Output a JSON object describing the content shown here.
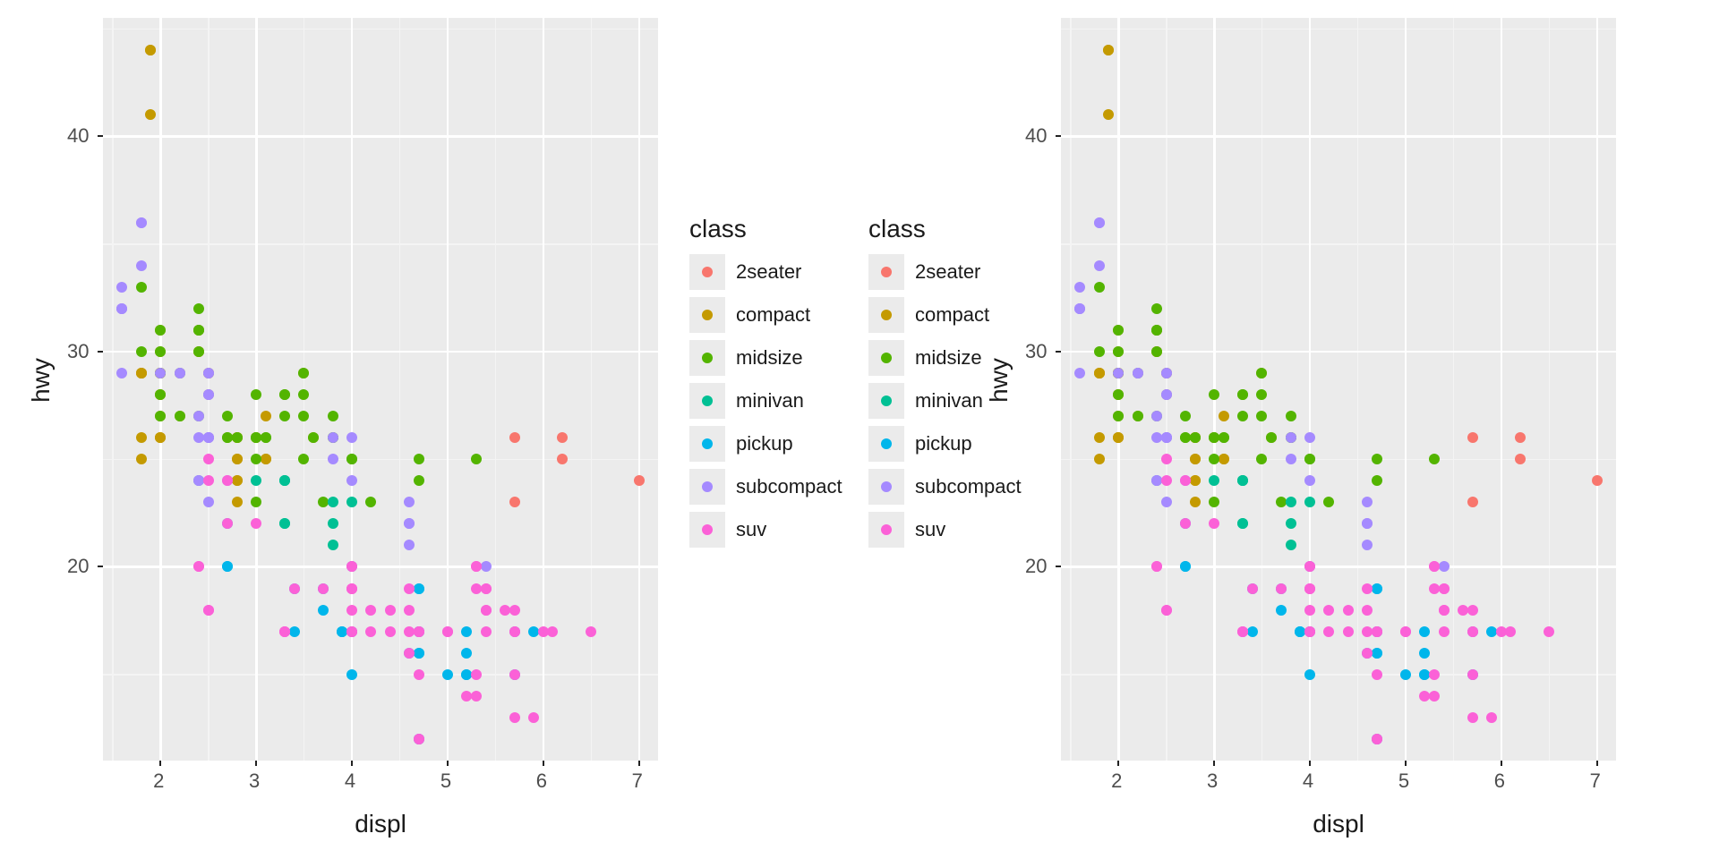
{
  "chart_data": [
    {
      "type": "scatter",
      "title": "",
      "xlabel": "displ",
      "ylabel": "hwy",
      "xlim": [
        1.4,
        7.2
      ],
      "ylim": [
        11,
        45.5
      ],
      "x_ticks": [
        2,
        3,
        4,
        5,
        6,
        7
      ],
      "y_ticks": [
        20,
        30,
        40
      ],
      "x_minor": [
        1.5,
        2.5,
        3.5,
        4.5,
        5.5,
        6.5
      ],
      "y_minor": [
        15,
        25,
        35,
        45
      ],
      "grid": true,
      "legend_title": "class",
      "legend_position": "right",
      "series": [
        {
          "name": "2seater",
          "color": "#F8766D",
          "x": [
            5.7,
            5.7,
            6.2,
            6.2,
            7.0
          ],
          "y": [
            26,
            23,
            26,
            25,
            24
          ]
        },
        {
          "name": "compact",
          "color": "#C49A00",
          "x": [
            1.8,
            1.8,
            2.0,
            2.0,
            2.8,
            2.8,
            3.1,
            1.8,
            1.8,
            2.0,
            2.0,
            2.8,
            2.8,
            3.1,
            3.1,
            2.4,
            2.4,
            2.0,
            2.0,
            2.0,
            2.0,
            2.8,
            1.9,
            2.0,
            2.0,
            2.0,
            2.0,
            2.5,
            2.5,
            2.8,
            2.8,
            1.9,
            1.9,
            2.0,
            2.0,
            2.5,
            2.5,
            1.8,
            1.8,
            2.0,
            2.0,
            2.8,
            2.8,
            3.6,
            2.2,
            2.2,
            2.4,
            2.4,
            3.0,
            3.0,
            3.5
          ],
          "y": [
            29,
            29,
            31,
            30,
            26,
            26,
            27,
            26,
            25,
            28,
            27,
            25,
            25,
            25,
            25,
            30,
            30,
            26,
            29,
            29,
            29,
            24,
            44,
            29,
            26,
            29,
            29,
            29,
            29,
            23,
            24,
            44,
            41,
            29,
            26,
            28,
            29,
            29,
            29,
            28,
            29,
            26,
            26,
            26,
            27,
            29,
            31,
            31,
            26,
            26,
            29
          ]
        },
        {
          "name": "midsize",
          "color": "#53B400",
          "x": [
            2.8,
            3.1,
            4.2,
            2.4,
            2.4,
            3.1,
            3.5,
            3.6,
            2.4,
            3.5,
            3.5,
            3.0,
            3.0,
            3.5,
            3.3,
            3.3,
            4.0,
            3.8,
            3.8,
            3.8,
            5.3,
            2.2,
            2.2,
            2.4,
            2.4,
            3.0,
            3.0,
            3.3,
            1.8,
            1.8,
            2.0,
            2.0,
            2.0,
            2.0,
            2.0,
            2.7,
            2.7,
            2.7,
            3.0,
            3.7,
            4.0,
            4.7,
            4.7
          ],
          "y": [
            26,
            26,
            23,
            27,
            30,
            26,
            29,
            26,
            32,
            28,
            27,
            26,
            25,
            25,
            27,
            28,
            25,
            26,
            26,
            27,
            25,
            29,
            27,
            31,
            31,
            28,
            26,
            28,
            30,
            33,
            30,
            28,
            27,
            29,
            31,
            26,
            26,
            27,
            23,
            23,
            25,
            25,
            24
          ]
        },
        {
          "name": "minivan",
          "color": "#00C094",
          "x": [
            2.4,
            3.0,
            3.3,
            3.3,
            3.3,
            3.3,
            3.3,
            3.8,
            3.8,
            3.8,
            4.0
          ],
          "y": [
            24,
            24,
            22,
            22,
            24,
            24,
            24,
            22,
            21,
            23,
            23
          ]
        },
        {
          "name": "pickup",
          "color": "#00B6EB",
          "x": [
            3.7,
            3.7,
            3.9,
            3.9,
            4.7,
            4.7,
            4.7,
            5.2,
            5.2,
            3.9,
            4.7,
            4.7,
            4.7,
            5.2,
            5.2,
            5.7,
            5.9,
            4.7,
            4.7,
            4.7,
            4.0,
            4.0,
            4.6,
            5.0,
            2.7,
            2.7,
            2.7,
            3.4,
            3.4,
            4.0,
            4.0,
            4.7,
            4.7,
            5.7
          ],
          "y": [
            19,
            18,
            17,
            17,
            19,
            19,
            12,
            17,
            15,
            17,
            12,
            17,
            16,
            15,
            16,
            15,
            17,
            16,
            17,
            17,
            17,
            17,
            16,
            15,
            20,
            20,
            22,
            17,
            19,
            20,
            15,
            17,
            17,
            17
          ]
        },
        {
          "name": "subcompact",
          "color": "#A58AFF",
          "x": [
            3.8,
            3.8,
            4.0,
            4.0,
            4.6,
            4.6,
            4.6,
            4.6,
            5.4,
            1.6,
            1.6,
            1.6,
            1.6,
            1.6,
            1.8,
            1.8,
            1.8,
            2.0,
            2.4,
            2.4,
            2.4,
            2.4,
            2.5,
            2.5,
            2.5,
            2.5,
            2.5,
            2.5,
            2.2,
            2.2,
            2.5,
            2.5,
            2.5,
            2.5,
            2.7
          ],
          "y": [
            26,
            25,
            26,
            24,
            21,
            22,
            23,
            22,
            20,
            33,
            32,
            32,
            29,
            32,
            34,
            36,
            36,
            29,
            26,
            27,
            24,
            24,
            26,
            26,
            26,
            23,
            26,
            26,
            29,
            29,
            28,
            28,
            29,
            29,
            24
          ]
        },
        {
          "name": "suv",
          "color": "#FB61D7",
          "x": [
            5.3,
            5.3,
            5.3,
            5.7,
            6.0,
            5.3,
            5.3,
            5.7,
            6.5,
            2.4,
            2.4,
            2.5,
            2.5,
            3.3,
            4.0,
            4.7,
            4.7,
            4.7,
            5.2,
            5.7,
            5.9,
            4.0,
            4.0,
            4.0,
            4.0,
            4.6,
            5.0,
            4.2,
            4.4,
            4.6,
            5.4,
            5.4,
            5.4,
            4.0,
            4.0,
            4.6,
            5.0,
            3.3,
            3.3,
            4.0,
            5.6,
            3.0,
            3.7,
            4.0,
            4.7,
            4.7,
            4.7,
            5.7,
            6.1,
            4.0,
            4.2,
            4.4,
            4.6,
            5.4,
            5.4,
            2.5,
            2.5,
            2.7,
            2.7,
            3.4,
            4.7,
            5.7
          ],
          "y": [
            20,
            15,
            20,
            17,
            17,
            19,
            14,
            15,
            17,
            20,
            20,
            18,
            18,
            17,
            17,
            12,
            17,
            15,
            14,
            13,
            13,
            17,
            19,
            19,
            17,
            16,
            17,
            17,
            17,
            18,
            18,
            19,
            19,
            17,
            19,
            19,
            17,
            17,
            17,
            20,
            18,
            22,
            19,
            20,
            17,
            12,
            17,
            18,
            17,
            18,
            18,
            18,
            17,
            17,
            18,
            25,
            24,
            24,
            22,
            19,
            17,
            17
          ]
        }
      ]
    },
    {
      "type": "scatter",
      "title": "",
      "xlabel": "displ",
      "ylabel": "hwy",
      "xlim": [
        1.4,
        7.2
      ],
      "ylim": [
        11,
        45.5
      ],
      "x_ticks": [
        2,
        3,
        4,
        5,
        6,
        7
      ],
      "y_ticks": [
        20,
        30,
        40
      ],
      "x_minor": [
        1.5,
        2.5,
        3.5,
        4.5,
        5.5,
        6.5
      ],
      "y_minor": [
        15,
        25,
        35,
        45
      ],
      "grid": true,
      "legend_title": "class",
      "legend_position": "left",
      "series": [
        {
          "name": "2seater",
          "color": "#F8766D",
          "x": [
            5.7,
            5.7,
            6.2,
            6.2,
            7.0
          ],
          "y": [
            26,
            23,
            26,
            25,
            24
          ]
        },
        {
          "name": "compact",
          "color": "#C49A00",
          "x": [
            1.8,
            1.8,
            2.0,
            2.0,
            2.8,
            2.8,
            3.1,
            1.8,
            1.8,
            2.0,
            2.0,
            2.8,
            2.8,
            3.1,
            3.1,
            2.4,
            2.4,
            2.0,
            2.0,
            2.0,
            2.0,
            2.8,
            1.9,
            2.0,
            2.0,
            2.0,
            2.0,
            2.5,
            2.5,
            2.8,
            2.8,
            1.9,
            1.9,
            2.0,
            2.0,
            2.5,
            2.5,
            1.8,
            1.8,
            2.0,
            2.0,
            2.8,
            2.8,
            3.6,
            2.2,
            2.2,
            2.4,
            2.4,
            3.0,
            3.0,
            3.5
          ],
          "y": [
            29,
            29,
            31,
            30,
            26,
            26,
            27,
            26,
            25,
            28,
            27,
            25,
            25,
            25,
            25,
            30,
            30,
            26,
            29,
            29,
            29,
            24,
            44,
            29,
            26,
            29,
            29,
            29,
            29,
            23,
            24,
            44,
            41,
            29,
            26,
            28,
            29,
            29,
            29,
            28,
            29,
            26,
            26,
            26,
            27,
            29,
            31,
            31,
            26,
            26,
            29
          ]
        },
        {
          "name": "midsize",
          "color": "#53B400",
          "x": [
            2.8,
            3.1,
            4.2,
            2.4,
            2.4,
            3.1,
            3.5,
            3.6,
            2.4,
            3.5,
            3.5,
            3.0,
            3.0,
            3.5,
            3.3,
            3.3,
            4.0,
            3.8,
            3.8,
            3.8,
            5.3,
            2.2,
            2.2,
            2.4,
            2.4,
            3.0,
            3.0,
            3.3,
            1.8,
            1.8,
            2.0,
            2.0,
            2.0,
            2.0,
            2.0,
            2.7,
            2.7,
            2.7,
            3.0,
            3.7,
            4.0,
            4.7,
            4.7
          ],
          "y": [
            26,
            26,
            23,
            27,
            30,
            26,
            29,
            26,
            32,
            28,
            27,
            26,
            25,
            25,
            27,
            28,
            25,
            26,
            26,
            27,
            25,
            29,
            27,
            31,
            31,
            28,
            26,
            28,
            30,
            33,
            30,
            28,
            27,
            29,
            31,
            26,
            26,
            27,
            23,
            23,
            25,
            25,
            24
          ]
        },
        {
          "name": "minivan",
          "color": "#00C094",
          "x": [
            2.4,
            3.0,
            3.3,
            3.3,
            3.3,
            3.3,
            3.3,
            3.8,
            3.8,
            3.8,
            4.0
          ],
          "y": [
            24,
            24,
            22,
            22,
            24,
            24,
            24,
            22,
            21,
            23,
            23
          ]
        },
        {
          "name": "pickup",
          "color": "#00B6EB",
          "x": [
            3.7,
            3.7,
            3.9,
            3.9,
            4.7,
            4.7,
            4.7,
            5.2,
            5.2,
            3.9,
            4.7,
            4.7,
            4.7,
            5.2,
            5.2,
            5.7,
            5.9,
            4.7,
            4.7,
            4.7,
            4.0,
            4.0,
            4.6,
            5.0,
            2.7,
            2.7,
            2.7,
            3.4,
            3.4,
            4.0,
            4.0,
            4.7,
            4.7,
            5.7
          ],
          "y": [
            19,
            18,
            17,
            17,
            19,
            19,
            12,
            17,
            15,
            17,
            12,
            17,
            16,
            15,
            16,
            15,
            17,
            16,
            17,
            17,
            17,
            17,
            16,
            15,
            20,
            20,
            22,
            17,
            19,
            20,
            15,
            17,
            17,
            17
          ]
        },
        {
          "name": "subcompact",
          "color": "#A58AFF",
          "x": [
            3.8,
            3.8,
            4.0,
            4.0,
            4.6,
            4.6,
            4.6,
            4.6,
            5.4,
            1.6,
            1.6,
            1.6,
            1.6,
            1.6,
            1.8,
            1.8,
            1.8,
            2.0,
            2.4,
            2.4,
            2.4,
            2.4,
            2.5,
            2.5,
            2.5,
            2.5,
            2.5,
            2.5,
            2.2,
            2.2,
            2.5,
            2.5,
            2.5,
            2.5,
            2.7
          ],
          "y": [
            26,
            25,
            26,
            24,
            21,
            22,
            23,
            22,
            20,
            33,
            32,
            32,
            29,
            32,
            34,
            36,
            36,
            29,
            26,
            27,
            24,
            24,
            26,
            26,
            26,
            23,
            26,
            26,
            29,
            29,
            28,
            28,
            29,
            29,
            24
          ]
        },
        {
          "name": "suv",
          "color": "#FB61D7",
          "x": [
            5.3,
            5.3,
            5.3,
            5.7,
            6.0,
            5.3,
            5.3,
            5.7,
            6.5,
            2.4,
            2.4,
            2.5,
            2.5,
            3.3,
            4.0,
            4.7,
            4.7,
            4.7,
            5.2,
            5.7,
            5.9,
            4.0,
            4.0,
            4.0,
            4.0,
            4.6,
            5.0,
            4.2,
            4.4,
            4.6,
            5.4,
            5.4,
            5.4,
            4.0,
            4.0,
            4.6,
            5.0,
            3.3,
            3.3,
            4.0,
            5.6,
            3.0,
            3.7,
            4.0,
            4.7,
            4.7,
            4.7,
            5.7,
            6.1,
            4.0,
            4.2,
            4.4,
            4.6,
            5.4,
            5.4,
            2.5,
            2.5,
            2.7,
            2.7,
            3.4,
            4.7,
            5.7
          ],
          "y": [
            20,
            15,
            20,
            17,
            17,
            19,
            14,
            15,
            17,
            20,
            20,
            18,
            18,
            17,
            17,
            12,
            17,
            15,
            14,
            13,
            13,
            17,
            19,
            19,
            17,
            16,
            17,
            17,
            17,
            18,
            18,
            19,
            19,
            17,
            19,
            19,
            17,
            17,
            17,
            20,
            18,
            22,
            19,
            20,
            17,
            12,
            17,
            18,
            17,
            18,
            18,
            18,
            17,
            17,
            18,
            25,
            24,
            24,
            22,
            19,
            17,
            17
          ]
        }
      ]
    }
  ]
}
